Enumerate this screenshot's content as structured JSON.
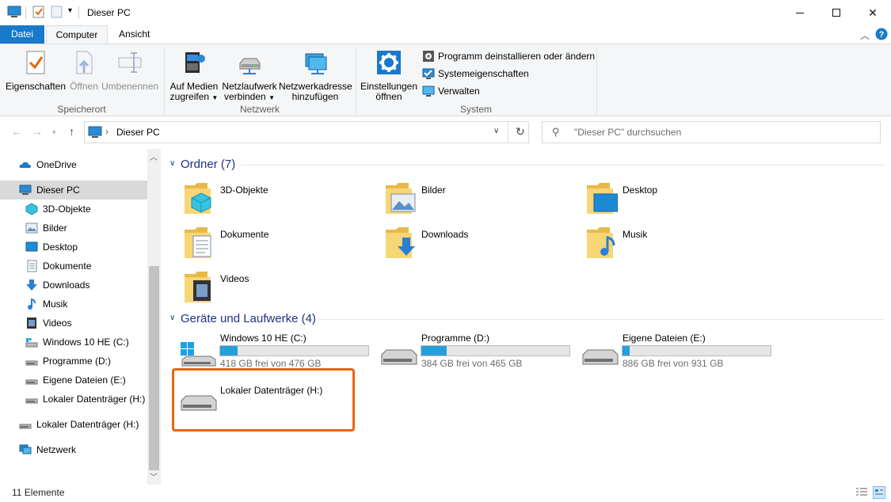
{
  "window": {
    "title": "Dieser PC"
  },
  "tabs": {
    "file": "Datei",
    "computer": "Computer",
    "view": "Ansicht"
  },
  "ribbon": {
    "properties": "Eigenschaften",
    "open": "Öffnen",
    "rename": "Umbenennen",
    "group_location": "Speicherort",
    "media_line1": "Auf Medien",
    "media_line2": "zugreifen",
    "mapdrive_line1": "Netzlaufwerk",
    "mapdrive_line2": "verbinden",
    "netloc_line1": "Netzwerkadresse",
    "netloc_line2": "hinzufügen",
    "group_network": "Netzwerk",
    "settings_line1": "Einstellungen",
    "settings_line2": "öffnen",
    "uninstall": "Programm deinstallieren oder ändern",
    "sysprops": "Systemeigenschaften",
    "manage": "Verwalten",
    "group_system": "System"
  },
  "address": {
    "path": "Dieser PC",
    "search_placeholder": "\"Dieser PC\" durchsuchen"
  },
  "sidebar": {
    "items": [
      {
        "label": "OneDrive"
      },
      {
        "label": "Dieser PC"
      },
      {
        "label": "3D-Objekte"
      },
      {
        "label": "Bilder"
      },
      {
        "label": "Desktop"
      },
      {
        "label": "Dokumente"
      },
      {
        "label": "Downloads"
      },
      {
        "label": "Musik"
      },
      {
        "label": "Videos"
      },
      {
        "label": "Windows 10 HE (C:)"
      },
      {
        "label": "Programme (D:)"
      },
      {
        "label": "Eigene Dateien (E:)"
      },
      {
        "label": "Lokaler Datenträger (H:)"
      },
      {
        "label": "Lokaler Datenträger (H:)"
      },
      {
        "label": "Netzwerk"
      }
    ]
  },
  "main": {
    "folders_header": "Ordner (7)",
    "folders": [
      {
        "label": "3D-Objekte"
      },
      {
        "label": "Bilder"
      },
      {
        "label": "Desktop"
      },
      {
        "label": "Dokumente"
      },
      {
        "label": "Downloads"
      },
      {
        "label": "Musik"
      },
      {
        "label": "Videos"
      }
    ],
    "drives_header": "Geräte und Laufwerke (4)",
    "drives": [
      {
        "name": "Windows 10 HE (C:)",
        "free": "418 GB frei von 476 GB",
        "used_fraction": 0.12
      },
      {
        "name": "Programme (D:)",
        "free": "384 GB frei von 465 GB",
        "used_fraction": 0.17
      },
      {
        "name": "Eigene Dateien (E:)",
        "free": "886 GB frei von 931 GB",
        "used_fraction": 0.05
      },
      {
        "name": "Lokaler Datenträger (H:)"
      }
    ]
  },
  "status": {
    "count": "11 Elemente"
  },
  "colors": {
    "accent": "#1979ca",
    "header": "#1e3287",
    "bar_fill": "#26a0da",
    "highlight": "#e8650f"
  }
}
